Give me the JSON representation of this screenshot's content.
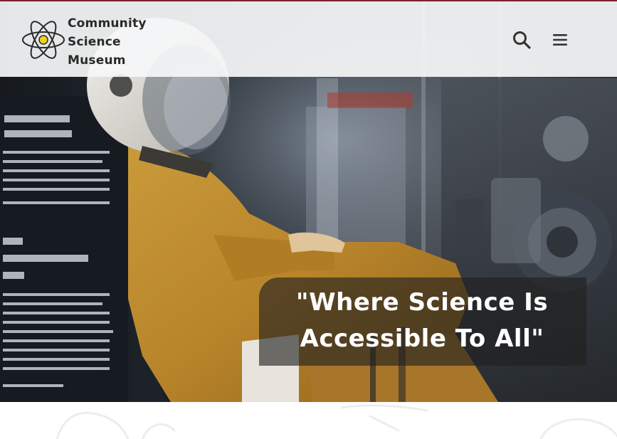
{
  "site": {
    "name_lines": [
      "Community",
      "Science",
      "Museum"
    ]
  },
  "header": {
    "search_icon": "search-icon",
    "menu_icon": "hamburger-menu-icon"
  },
  "hero": {
    "tagline_line1": "\"Where Science Is",
    "tagline_line2": "Accessible To All\""
  },
  "colors": {
    "header_bg": "#f5f6f7",
    "header_top_border": "#7a2230",
    "logo_text": "#2a2a2a",
    "atom_yellow": "#f2d21c",
    "tagline_bg": "rgba(30,30,30,0.62)",
    "tagline_text": "#ffffff"
  }
}
